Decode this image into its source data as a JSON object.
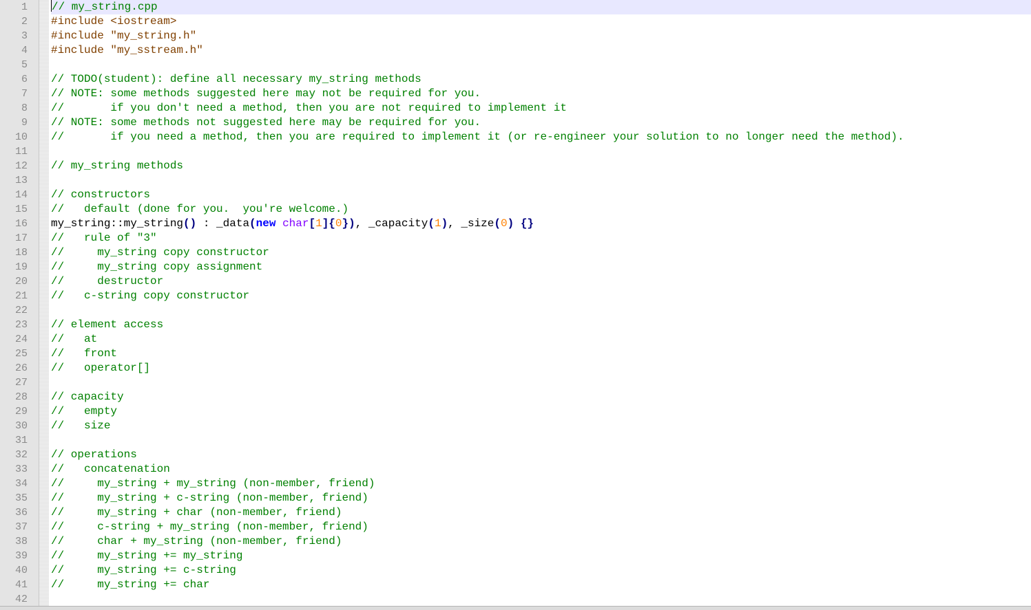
{
  "editor": {
    "current_line": 1,
    "lines": [
      {
        "n": "1",
        "tokens": [
          {
            "t": "comment",
            "v": "// my_string.cpp"
          }
        ]
      },
      {
        "n": "2",
        "tokens": [
          {
            "t": "pp",
            "v": "#include <iostream>"
          }
        ]
      },
      {
        "n": "3",
        "tokens": [
          {
            "t": "pp",
            "v": "#include \"my_string.h\""
          }
        ]
      },
      {
        "n": "4",
        "tokens": [
          {
            "t": "pp",
            "v": "#include \"my_sstream.h\""
          }
        ]
      },
      {
        "n": "5",
        "tokens": []
      },
      {
        "n": "6",
        "tokens": [
          {
            "t": "comment",
            "v": "// TODO(student): define all necessary my_string methods"
          }
        ]
      },
      {
        "n": "7",
        "tokens": [
          {
            "t": "comment",
            "v": "// NOTE: some methods suggested here may not be required for you."
          }
        ]
      },
      {
        "n": "8",
        "tokens": [
          {
            "t": "comment",
            "v": "//       if you don't need a method, then you are not required to implement it"
          }
        ]
      },
      {
        "n": "9",
        "tokens": [
          {
            "t": "comment",
            "v": "// NOTE: some methods not suggested here may be required for you."
          }
        ]
      },
      {
        "n": "10",
        "tokens": [
          {
            "t": "comment",
            "v": "//       if you need a method, then you are required to implement it (or re-engineer your solution to no longer need the method)."
          }
        ]
      },
      {
        "n": "11",
        "tokens": []
      },
      {
        "n": "12",
        "tokens": [
          {
            "t": "comment",
            "v": "// my_string methods"
          }
        ]
      },
      {
        "n": "13",
        "tokens": []
      },
      {
        "n": "14",
        "tokens": [
          {
            "t": "comment",
            "v": "// constructors"
          }
        ]
      },
      {
        "n": "15",
        "tokens": [
          {
            "t": "comment",
            "v": "//   default (done for you.  you're welcome.)"
          }
        ]
      },
      {
        "n": "16",
        "tokens": [
          {
            "t": "plain",
            "v": "my_string::my_string"
          },
          {
            "t": "op",
            "v": "()"
          },
          {
            "t": "plain",
            "v": " : _data"
          },
          {
            "t": "op",
            "v": "("
          },
          {
            "t": "kw",
            "v": "new"
          },
          {
            "t": "plain",
            "v": " "
          },
          {
            "t": "type",
            "v": "char"
          },
          {
            "t": "op",
            "v": "["
          },
          {
            "t": "num",
            "v": "1"
          },
          {
            "t": "op",
            "v": "]{"
          },
          {
            "t": "num",
            "v": "0"
          },
          {
            "t": "op",
            "v": "})"
          },
          {
            "t": "plain",
            "v": ", _capacity"
          },
          {
            "t": "op",
            "v": "("
          },
          {
            "t": "num",
            "v": "1"
          },
          {
            "t": "op",
            "v": ")"
          },
          {
            "t": "plain",
            "v": ", _size"
          },
          {
            "t": "op",
            "v": "("
          },
          {
            "t": "num",
            "v": "0"
          },
          {
            "t": "op",
            "v": ")"
          },
          {
            "t": "plain",
            "v": " "
          },
          {
            "t": "op",
            "v": "{}"
          }
        ]
      },
      {
        "n": "17",
        "tokens": [
          {
            "t": "comment",
            "v": "//   rule of \"3\""
          }
        ]
      },
      {
        "n": "18",
        "tokens": [
          {
            "t": "comment",
            "v": "//     my_string copy constructor"
          }
        ]
      },
      {
        "n": "19",
        "tokens": [
          {
            "t": "comment",
            "v": "//     my_string copy assignment"
          }
        ]
      },
      {
        "n": "20",
        "tokens": [
          {
            "t": "comment",
            "v": "//     destructor"
          }
        ]
      },
      {
        "n": "21",
        "tokens": [
          {
            "t": "comment",
            "v": "//   c-string copy constructor"
          }
        ]
      },
      {
        "n": "22",
        "tokens": []
      },
      {
        "n": "23",
        "tokens": [
          {
            "t": "comment",
            "v": "// element access"
          }
        ]
      },
      {
        "n": "24",
        "tokens": [
          {
            "t": "comment",
            "v": "//   at"
          }
        ]
      },
      {
        "n": "25",
        "tokens": [
          {
            "t": "comment",
            "v": "//   front"
          }
        ]
      },
      {
        "n": "26",
        "tokens": [
          {
            "t": "comment",
            "v": "//   operator[]"
          }
        ]
      },
      {
        "n": "27",
        "tokens": []
      },
      {
        "n": "28",
        "tokens": [
          {
            "t": "comment",
            "v": "// capacity"
          }
        ]
      },
      {
        "n": "29",
        "tokens": [
          {
            "t": "comment",
            "v": "//   empty"
          }
        ]
      },
      {
        "n": "30",
        "tokens": [
          {
            "t": "comment",
            "v": "//   size"
          }
        ]
      },
      {
        "n": "31",
        "tokens": []
      },
      {
        "n": "32",
        "tokens": [
          {
            "t": "comment",
            "v": "// operations"
          }
        ]
      },
      {
        "n": "33",
        "tokens": [
          {
            "t": "comment",
            "v": "//   concatenation"
          }
        ]
      },
      {
        "n": "34",
        "tokens": [
          {
            "t": "comment",
            "v": "//     my_string + my_string (non-member, friend)"
          }
        ]
      },
      {
        "n": "35",
        "tokens": [
          {
            "t": "comment",
            "v": "//     my_string + c-string (non-member, friend)"
          }
        ]
      },
      {
        "n": "36",
        "tokens": [
          {
            "t": "comment",
            "v": "//     my_string + char (non-member, friend)"
          }
        ]
      },
      {
        "n": "37",
        "tokens": [
          {
            "t": "comment",
            "v": "//     c-string + my_string (non-member, friend)"
          }
        ]
      },
      {
        "n": "38",
        "tokens": [
          {
            "t": "comment",
            "v": "//     char + my_string (non-member, friend)"
          }
        ]
      },
      {
        "n": "39",
        "tokens": [
          {
            "t": "comment",
            "v": "//     my_string += my_string"
          }
        ]
      },
      {
        "n": "40",
        "tokens": [
          {
            "t": "comment",
            "v": "//     my_string += c-string"
          }
        ]
      },
      {
        "n": "41",
        "tokens": [
          {
            "t": "comment",
            "v": "//     my_string += char"
          }
        ]
      },
      {
        "n": "42",
        "tokens": []
      }
    ]
  }
}
